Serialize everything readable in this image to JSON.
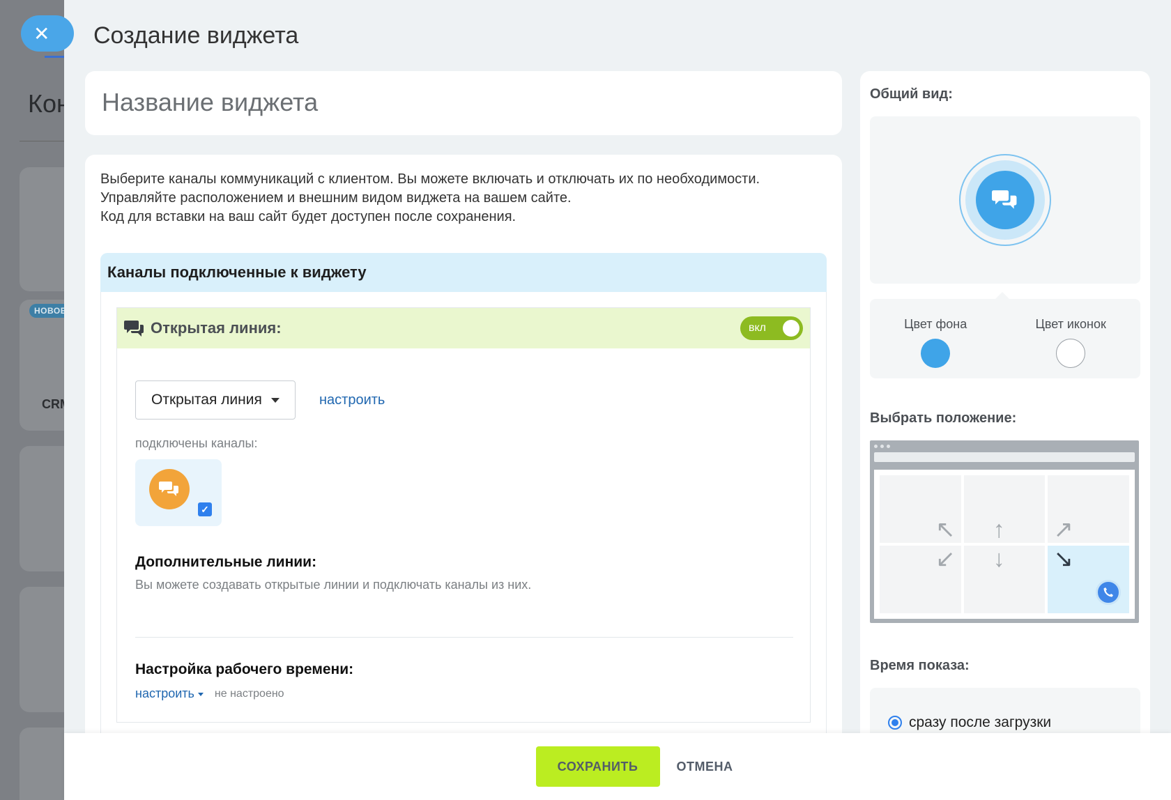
{
  "background": {
    "title": "Кон",
    "badge": "НОВОЕ",
    "crm_label": "CRM"
  },
  "panel": {
    "title": "Создание виджета",
    "name_placeholder": "Название виджета",
    "description": [
      "Выберите каналы коммуникаций с клиентом. Вы можете включать и отключать их по необходимости.",
      "Управляйте расположением и внешним видом виджета на вашем сайте.",
      "Код для вставки на ваш сайт будет доступен после сохранения."
    ],
    "channels_header": "Каналы подключенные к виджету",
    "open_line": {
      "title": "Открытая линия:",
      "toggle_label": "вкл",
      "toggle_on": true,
      "select_value": "Открытая линия",
      "configure_link": "настроить",
      "connected_label": "подключены каналы:",
      "channel_checked": true
    },
    "extra_lines": {
      "title": "Дополнительные линии:",
      "desc": "Вы можете создавать открытые линии и подключать каналы из них."
    },
    "work_time": {
      "title": "Настройка рабочего времени:",
      "configure_link": "настроить",
      "status": "не настроено"
    }
  },
  "side": {
    "overview_title": "Общий вид:",
    "bg_color_label": "Цвет фона",
    "icon_color_label": "Цвет иконок",
    "bg_color": "#3fa4e8",
    "icon_color": "#ffffff",
    "position_title": "Выбрать положение:",
    "selected_position": "bottom-right",
    "show_time_title": "Время показа:",
    "show_time_option": "сразу после загрузки"
  },
  "footer": {
    "save": "СОХРАНИТЬ",
    "cancel": "ОТМЕНА"
  }
}
